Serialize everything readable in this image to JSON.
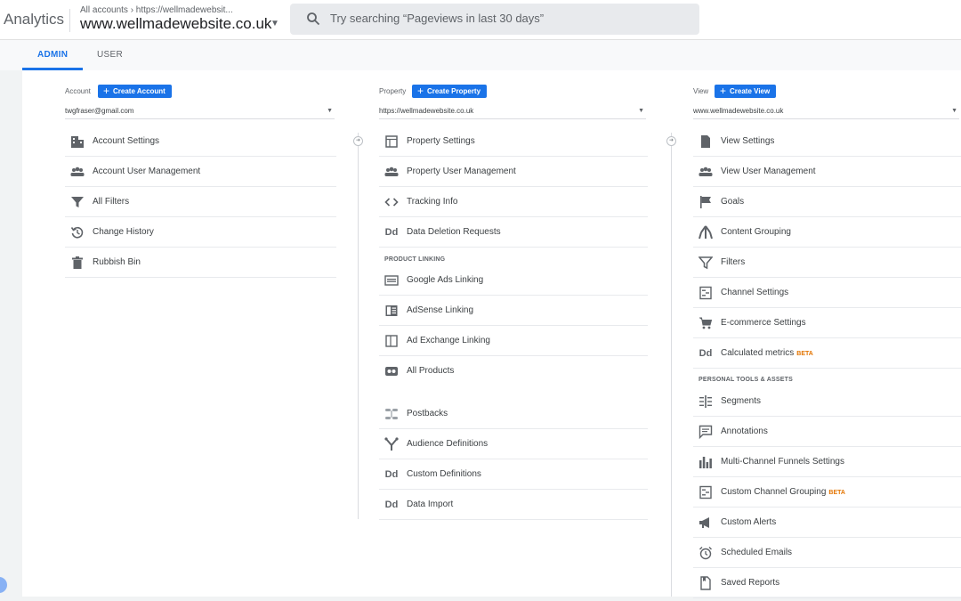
{
  "header": {
    "app_title": "Analytics",
    "breadcrumb": "All accounts › https://wellmadewebsit...",
    "property_name": "www.wellmadewebsite.co.uk",
    "property_caret_icon": "caret-down-icon",
    "search_placeholder": "Try searching “Pageviews in last 30 days”",
    "search_icon": "search-icon"
  },
  "tabs": [
    {
      "label": "ADMIN",
      "active": true
    },
    {
      "label": "USER",
      "active": false
    }
  ],
  "colors": {
    "accent": "#1a73e8",
    "beta": "#e37400"
  },
  "account": {
    "label": "Account",
    "create_label": "Create Account",
    "selected": "twgfraser@gmail.com",
    "items": [
      {
        "label": "Account Settings",
        "icon": "building-icon"
      },
      {
        "label": "Account User Management",
        "icon": "people-icon"
      },
      {
        "label": "All Filters",
        "icon": "filter-icon"
      },
      {
        "label": "Change History",
        "icon": "history-icon"
      },
      {
        "label": "Rubbish Bin",
        "icon": "trash-icon"
      }
    ]
  },
  "property": {
    "label": "Property",
    "create_label": "Create Property",
    "selected": "https://wellmadewebsite.co.uk",
    "items": [
      {
        "label": "Property Settings",
        "icon": "settings-page-icon"
      },
      {
        "label": "Property User Management",
        "icon": "people-icon"
      },
      {
        "label": "Tracking Info",
        "icon": "code-icon"
      },
      {
        "label": "Data Deletion Requests",
        "icon": "dd-icon"
      }
    ],
    "section_label": "PRODUCT LINKING",
    "linking_items": [
      {
        "label": "Google Ads Linking",
        "icon": "ads-icon"
      },
      {
        "label": "AdSense Linking",
        "icon": "adsense-icon"
      },
      {
        "label": "Ad Exchange Linking",
        "icon": "ad-exchange-icon"
      },
      {
        "label": "All Products",
        "icon": "all-products-icon"
      }
    ],
    "other_items": [
      {
        "label": "Postbacks",
        "icon": "postbacks-icon"
      },
      {
        "label": "Audience Definitions",
        "icon": "audience-icon"
      },
      {
        "label": "Custom Definitions",
        "icon": "dd-icon"
      },
      {
        "label": "Data Import",
        "icon": "dd-icon"
      }
    ]
  },
  "view": {
    "label": "View",
    "create_label": "Create View",
    "selected": "www.wellmadewebsite.co.uk",
    "items": [
      {
        "label": "View Settings",
        "icon": "document-icon"
      },
      {
        "label": "View User Management",
        "icon": "people-icon"
      },
      {
        "label": "Goals",
        "icon": "flag-icon"
      },
      {
        "label": "Content Grouping",
        "icon": "grouping-icon"
      },
      {
        "label": "Filters",
        "icon": "filter-icon"
      },
      {
        "label": "Channel Settings",
        "icon": "channel-icon"
      },
      {
        "label": "E-commerce Settings",
        "icon": "cart-icon"
      },
      {
        "label": "Calculated metrics",
        "icon": "dd-icon",
        "badge": "BETA"
      }
    ],
    "section_label": "PERSONAL TOOLS & ASSETS",
    "personal_items": [
      {
        "label": "Segments",
        "icon": "segments-icon"
      },
      {
        "label": "Annotations",
        "icon": "comment-icon"
      },
      {
        "label": "Multi-Channel Funnels Settings",
        "icon": "bar-chart-icon"
      },
      {
        "label": "Custom Channel Grouping",
        "icon": "channel-icon",
        "badge": "BETA"
      },
      {
        "label": "Custom Alerts",
        "icon": "megaphone-icon"
      },
      {
        "label": "Scheduled Emails",
        "icon": "clock-icon"
      },
      {
        "label": "Saved Reports",
        "icon": "saved-report-icon"
      }
    ]
  }
}
